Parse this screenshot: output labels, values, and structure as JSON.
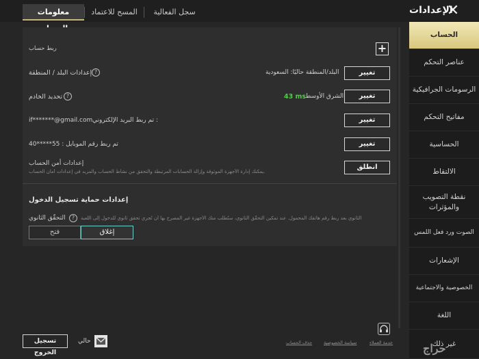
{
  "header": {
    "title": "الإعدادات",
    "tabs": [
      {
        "label": "معلومات الحساب",
        "active": true
      },
      {
        "label": "المسح للاعتماد",
        "active": false
      },
      {
        "label": "سجل الفعالية",
        "active": false
      }
    ]
  },
  "sidebar": {
    "items": [
      {
        "label": "الحساب",
        "active": true
      },
      {
        "label": "عناصر التحكم"
      },
      {
        "label": "الرسومات الجرافيكية"
      },
      {
        "label": "مفاتيح التحكم"
      },
      {
        "label": "الحساسية"
      },
      {
        "label": "الالتقاط"
      },
      {
        "label": "نقطة التصويب والمؤثرات"
      },
      {
        "label": "الصوت ورد فعل اللمس"
      },
      {
        "label": "الإشعارات"
      },
      {
        "label": "الخصوصية والاجتماعية"
      },
      {
        "label": "اللغة"
      },
      {
        "label": "غير ذلك"
      }
    ]
  },
  "account": {
    "link_account_label": "ربط حساب",
    "country_label": "إعدادات البلد / المنطقة",
    "country_value": "البلد/المنطقة حاليًا: السعودية",
    "server_label": "تحديد الخادم",
    "server_region": "الشرق الأوسط",
    "server_ping": "43 ms",
    "email_label": "تم ربط البريد الإلكتروني :",
    "email_value": "if*******@gmail.com",
    "phone_label": "تم ربط رقم الموبايل : 55*****40",
    "security_label": "إعدادات أمن الحساب",
    "security_desc": "يمكنك إدارة الأجهزة الموثوقة وإزالة الحسابات المرتبطة والتحقق من نشاط الحساب والمزيد في إعدادات أمان الحساب.",
    "change_label": "تغيير",
    "launch_label": "انطلق"
  },
  "login_protection": {
    "title": "إعدادات حماية تسجيل الدخول",
    "twofa_label": "التحقّق الثانوي",
    "twofa_desc": "الثانوي بعد ربط رقم هاتفك المحمول. عند تمكين التحقّق الثانوي، ستُطلب منك الأجهزة غير المصرح بها أن تُجري تحقق ثانوي للدخول إلى اللعبة",
    "close_label": "إغلاق",
    "open_label": "فتح",
    "selected": "إغلاق"
  },
  "footer": {
    "logout_label": "تسجيل الخروج",
    "current_label": "حالي",
    "links": [
      "حذف الحساب",
      "سياسة الخصوصية",
      "خدمة العملاء"
    ],
    "watermark": "حراج"
  },
  "colors": {
    "active_tab": "#e6d89a",
    "ping": "#47d33a",
    "toggle_on": "#6fd1c8"
  }
}
